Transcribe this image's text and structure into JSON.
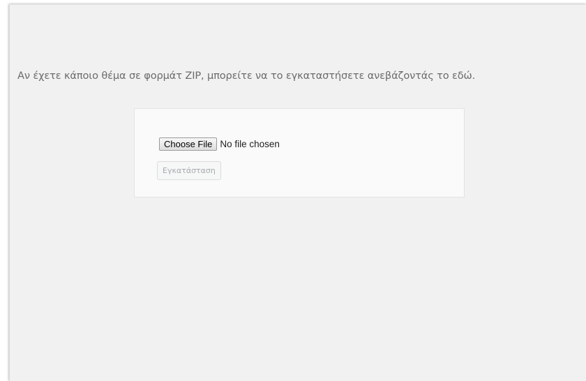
{
  "upload_theme": {
    "description": "Αν έχετε κάποιο θέμα σε φορμάτ ZIP, μπορείτε να το εγκαταστήσετε ανεβάζοντάς το εδώ.",
    "choose_file_label": "Choose File",
    "file_status": "No file chosen",
    "install_label": "Εγκατάσταση"
  }
}
